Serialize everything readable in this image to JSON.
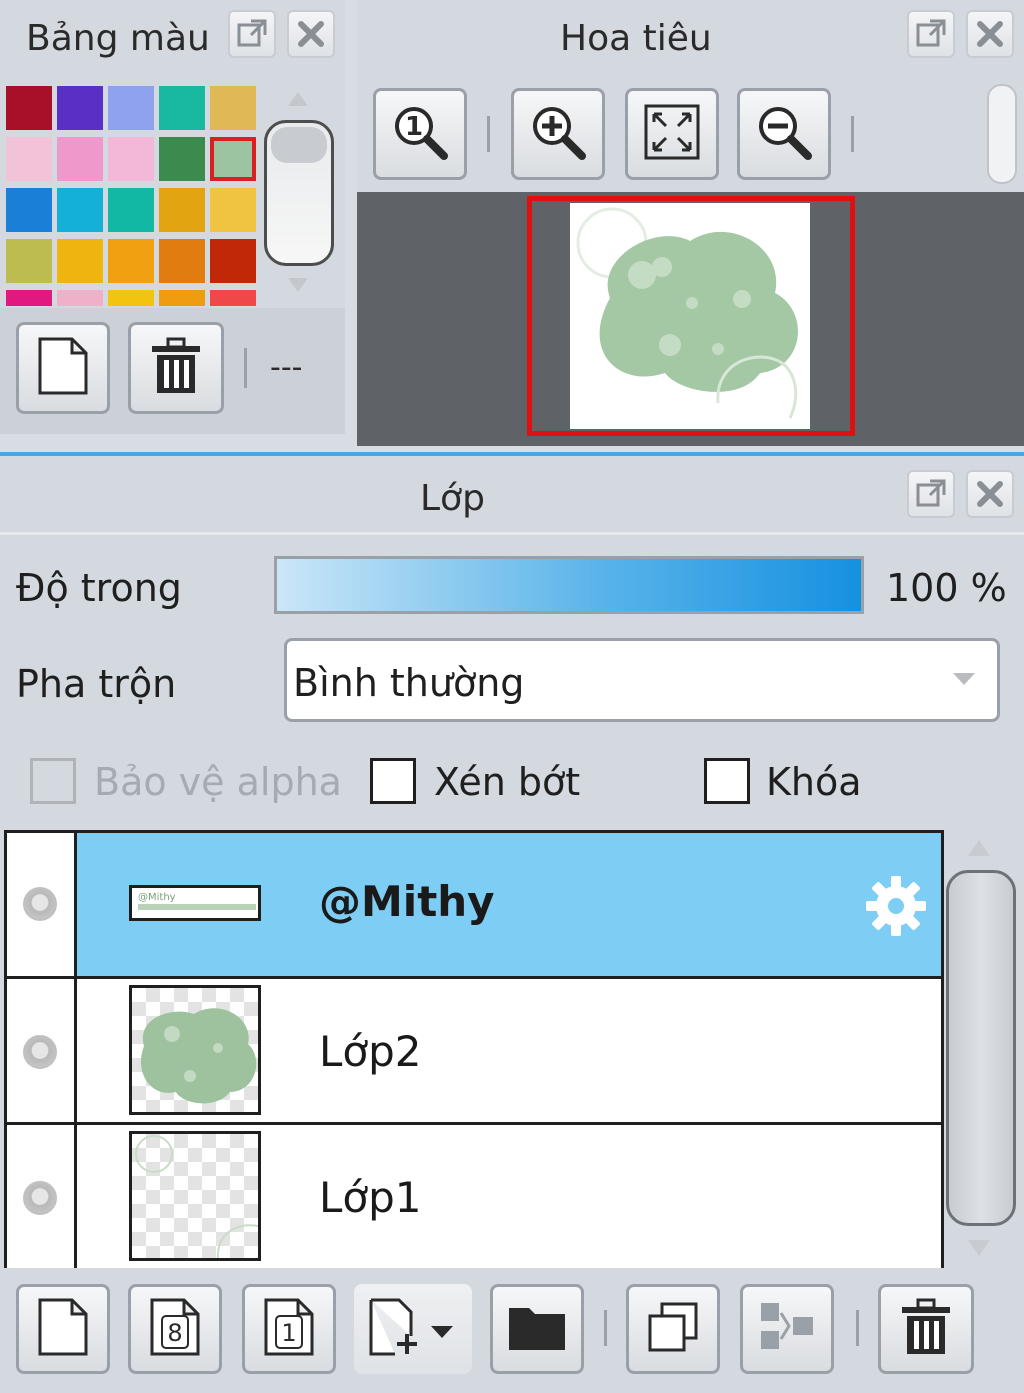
{
  "palette": {
    "title": "Bảng màu",
    "swatches": [
      {
        "color": "#a8102a"
      },
      {
        "color": "#5a2fc4"
      },
      {
        "color": "#8fa2f0"
      },
      {
        "color": "#19b8a0"
      },
      {
        "color": "#e0b855"
      },
      {
        "color": "#f2c2d8"
      },
      {
        "color": "#ef98cc"
      },
      {
        "color": "#f3b8d8"
      },
      {
        "color": "#3d8a4e"
      },
      {
        "color": "#9cc4a0",
        "selected": true
      },
      {
        "color": "#1a7fd6"
      },
      {
        "color": "#14b0d8"
      },
      {
        "color": "#12b8a4"
      },
      {
        "color": "#e2a410"
      },
      {
        "color": "#f0c440"
      },
      {
        "color": "#bcbc50"
      },
      {
        "color": "#f0b410"
      },
      {
        "color": "#f0a010"
      },
      {
        "color": "#e07c10"
      },
      {
        "color": "#c02808"
      },
      {
        "color": "#e01880"
      },
      {
        "color": "#f0b0c8"
      },
      {
        "color": "#f2c410"
      },
      {
        "color": "#f09c10"
      },
      {
        "color": "#f04848"
      }
    ],
    "new_icon": "page-icon",
    "delete_icon": "trash-icon",
    "dropdown_text": "---"
  },
  "navigator": {
    "title": "Hoa tiêu",
    "buttons": [
      {
        "icon": "zoom-actual-size-icon"
      },
      {
        "icon": "zoom-in-icon"
      },
      {
        "icon": "fit-screen-icon"
      },
      {
        "icon": "zoom-out-icon"
      }
    ]
  },
  "layers": {
    "title": "Lớp",
    "opacity_label": "Độ trong",
    "opacity_value": "100 %",
    "opacity_fraction": 1.0,
    "blend_label": "Pha trộn",
    "blend_value": "Bình thường",
    "protect_alpha_label": "Bảo vệ alpha",
    "clip_label": "Xén bớt",
    "lock_label": "Khóa",
    "items": [
      {
        "name": "@Mithy",
        "selected": true,
        "bold": true,
        "icon": "gear-icon"
      },
      {
        "name": "Lớp2",
        "selected": false
      },
      {
        "name": "Lớp1",
        "selected": false
      }
    ],
    "toolbar_icons": [
      "new-layer-icon",
      "new-8bit-layer-icon",
      "new-1bit-layer-icon",
      "add-layer-menu-icon",
      "folder-icon",
      "duplicate-layer-icon",
      "merge-down-icon",
      "trash-icon"
    ]
  },
  "colors": {
    "selection_blue": "#7ecdf5",
    "accent_red": "#e01010"
  }
}
